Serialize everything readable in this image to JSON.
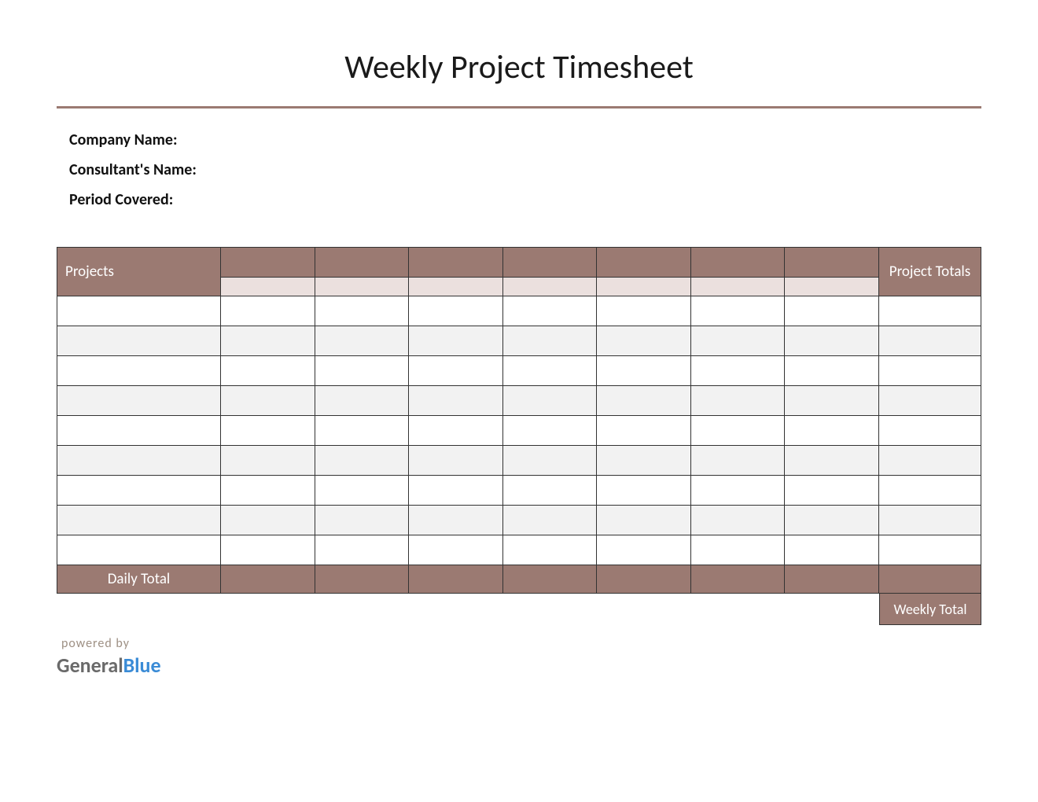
{
  "title": "Weekly Project Timesheet",
  "fields": {
    "company": "Company Name:",
    "consultant": "Consultant's Name:",
    "period": "Period Covered:"
  },
  "table": {
    "projects_header": "Projects",
    "totals_header": "Project Totals",
    "day_headers": [
      "",
      "",
      "",
      "",
      "",
      "",
      ""
    ],
    "day_subheaders": [
      "",
      "",
      "",
      "",
      "",
      "",
      ""
    ],
    "rows": [
      [
        "",
        "",
        "",
        "",
        "",
        "",
        "",
        "",
        ""
      ],
      [
        "",
        "",
        "",
        "",
        "",
        "",
        "",
        "",
        ""
      ],
      [
        "",
        "",
        "",
        "",
        "",
        "",
        "",
        "",
        ""
      ],
      [
        "",
        "",
        "",
        "",
        "",
        "",
        "",
        "",
        ""
      ],
      [
        "",
        "",
        "",
        "",
        "",
        "",
        "",
        "",
        ""
      ],
      [
        "",
        "",
        "",
        "",
        "",
        "",
        "",
        "",
        ""
      ],
      [
        "",
        "",
        "",
        "",
        "",
        "",
        "",
        "",
        ""
      ],
      [
        "",
        "",
        "",
        "",
        "",
        "",
        "",
        "",
        ""
      ],
      [
        "",
        "",
        "",
        "",
        "",
        "",
        "",
        "",
        ""
      ]
    ],
    "daily_total_label": "Daily Total",
    "daily_totals": [
      "",
      "",
      "",
      "",
      "",
      "",
      "",
      ""
    ],
    "weekly_total_label": "Weekly Total"
  },
  "footer": {
    "powered": "powered by",
    "logo_a": "General",
    "logo_b": "Blue"
  },
  "colors": {
    "accent": "#9b7a72",
    "alt_row": "#f2f2f2",
    "sub_header": "#ebe0de"
  }
}
